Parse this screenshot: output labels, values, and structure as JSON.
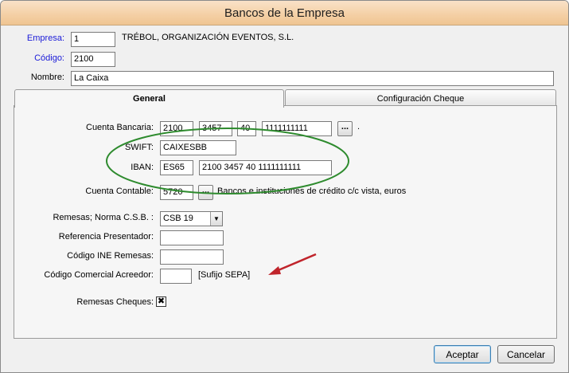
{
  "window": {
    "title": "Bancos de la Empresa"
  },
  "header": {
    "empresa_label": "Empresa:",
    "empresa_value": "1",
    "empresa_name": "TRÉBOL, ORGANIZACIÓN EVENTOS, S.L.",
    "codigo_label": "Código:",
    "codigo_value": "2100",
    "nombre_label": "Nombre:",
    "nombre_value": "La Caixa"
  },
  "tabs": [
    {
      "label": "General",
      "active": true
    },
    {
      "label": "Configuración Cheque",
      "active": false
    }
  ],
  "general": {
    "cuenta_bancaria_label": "Cuenta Bancaria:",
    "cuenta_bancaria": [
      "2100",
      "3457",
      "40",
      "1111111111"
    ],
    "cuenta_dot": ".",
    "swift_label": "SWIFT:",
    "swift_value": "CAIXESBB",
    "iban_label": "IBAN:",
    "iban_prefix": "ES65",
    "iban_value": "2100 3457 40 1111111111",
    "cuenta_contable_label": "Cuenta Contable:",
    "cuenta_contable_value": "5720",
    "cuenta_contable_desc": "Bancos e instituciones de crédito c/c vista, euros",
    "remesas_norma_label": "Remesas; Norma C.S.B. :",
    "remesas_norma_value": "CSB 19",
    "referencia_label": "Referencia Presentador:",
    "referencia_value": "",
    "codigo_ine_label": "Código INE Remesas:",
    "codigo_ine_value": "",
    "codigo_comercial_label": "Código Comercial Acreedor:",
    "codigo_comercial_value": "",
    "sufijo_note": "[Sufijo SEPA]",
    "remesas_cheques_label": "Remesas Cheques:",
    "remesas_cheques_checked": true,
    "ellipsis": "..."
  },
  "buttons": {
    "aceptar": "Aceptar",
    "cancelar": "Cancelar"
  },
  "annotations": {
    "ellipse_color": "#2e8b2e",
    "arrow_color": "#c0242b"
  }
}
